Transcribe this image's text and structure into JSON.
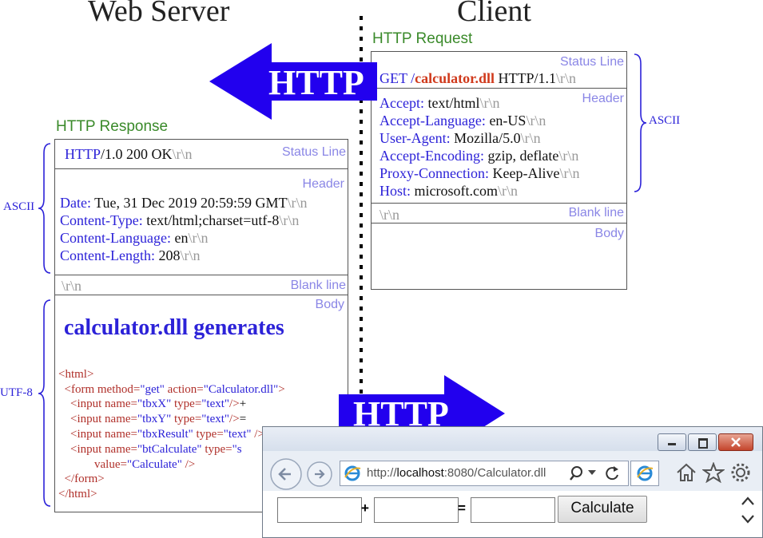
{
  "titles": {
    "server": "Web Server",
    "client": "Client"
  },
  "arrows": {
    "top_label": "HTTP",
    "bottom_label": "HTTP",
    "color": "#2200ee"
  },
  "request": {
    "heading": "HTTP Request",
    "status_label": "Status Line",
    "status": {
      "method": "GET /",
      "path": "calculator.dll",
      "version": " HTTP/1.1",
      "crlf": "\\r\\n"
    },
    "header_label": "Header",
    "headers": [
      {
        "k": "Accept:",
        "v": " text/html",
        "crlf": "\\r\\n"
      },
      {
        "k": "Accept-Language:",
        "v": " en-US",
        "crlf": "\\r\\n"
      },
      {
        "k": "User-Agent:",
        "v": " Mozilla/5.0",
        "crlf": "\\r\\n"
      },
      {
        "k": "Accept-Encoding:",
        "v": " gzip, deflate",
        "crlf": "\\r\\n"
      },
      {
        "k": "Proxy-Connection:",
        "v": " Keep-Alive",
        "crlf": "\\r\\n"
      },
      {
        "k": "Host:",
        "v": " microsoft.com",
        "crlf": "\\r\\n"
      }
    ],
    "blank_crlf": "\\r\\n",
    "blank_label": "Blank line",
    "body_label": "Body",
    "brace_label": "ASCII"
  },
  "response": {
    "heading": "HTTP Response",
    "status_label": "Status Line",
    "status": {
      "proto": "HTTP",
      "rest": "/1.0 200 OK",
      "crlf": "\\r\\n"
    },
    "header_label": "Header",
    "headers": [
      {
        "k": "Date:",
        "v": " Tue, 31 Dec 2019 20:59:59 GMT",
        "crlf": "\\r\\n"
      },
      {
        "k": "Content-Type:",
        "v": " text/html;charset=utf-8",
        "crlf": "\\r\\n"
      },
      {
        "k": "Content-Language:",
        "v": " en",
        "crlf": "\\r\\n"
      },
      {
        "k": "Content-Length:",
        "v": " 208",
        "crlf": "\\r\\n"
      }
    ],
    "blank_crlf": "\\r\\n",
    "blank_label": "Blank line",
    "body_label": "Body",
    "body_heading": "calculator.dll generates",
    "brace_ascii": "ASCII",
    "brace_utf8": "UTF-8",
    "code": {
      "l1": "<html>",
      "l2": {
        "indent": "  ",
        "tag": "<form ",
        "a1": "method=",
        "v1": "\"get\"",
        "a2": " action=",
        "v2": "\"Calculator.dll\"",
        "end": ">"
      },
      "l3": {
        "indent": "    ",
        "tag": "<input ",
        "a1": "name=",
        "v1": "\"tbxX\"",
        "a2": " type=",
        "v2": "\"text\"",
        "end": "/>",
        "tail": "+"
      },
      "l4": {
        "indent": "    ",
        "tag": "<input ",
        "a1": "name=",
        "v1": "\"tbxY\"",
        "a2": " type=",
        "v2": "\"text\"",
        "end": "/>",
        "tail": "="
      },
      "l5": {
        "indent": "    ",
        "tag": "<input ",
        "a1": "name=",
        "v1": "\"tbxResult\"",
        "a2": " type=",
        "v2": "\"text\"",
        "end": " />"
      },
      "l6": {
        "indent": "    ",
        "tag": "<input ",
        "a1": "name=",
        "v1": "\"btCalculate\"",
        "a2": " type=",
        "v2": "\"s"
      },
      "l7": {
        "indent": "            ",
        "a1": "value=",
        "v1": "\"Calculate\"",
        "end": " />"
      },
      "l8": "  </form>",
      "l9": "</html>"
    }
  },
  "browser": {
    "url_prefix": "http://",
    "url_host": "localhost",
    "url_rest": ":8080/Calculator.dll",
    "search_icon": "magnifier-icon",
    "plus": "+",
    "equals": "=",
    "button_label": "Calculate",
    "tbx_x": "",
    "tbx_y": "",
    "tbx_result": ""
  }
}
